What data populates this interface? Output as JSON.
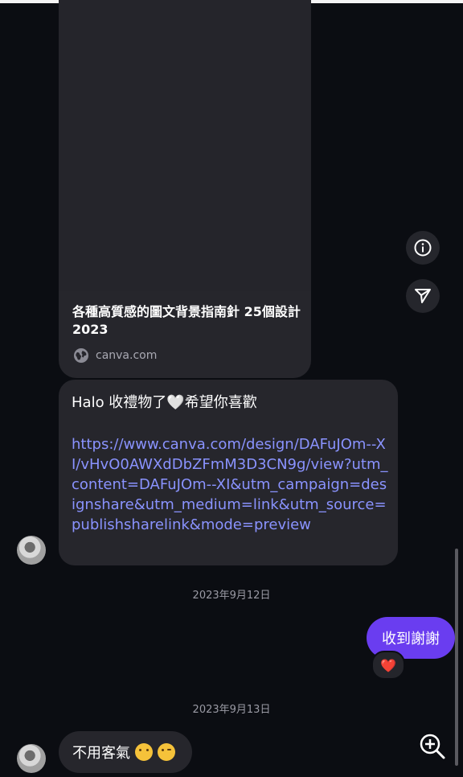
{
  "link_preview": {
    "title": "各種高質感的圖文背景指南針 25個設計 2023",
    "domain": "canva.com"
  },
  "messages": {
    "received_link": {
      "text": "Halo 收禮物了🤍希望你喜歡",
      "link": "https://www.canva.com/design/DAFuJOm--XI/vHvO0AWXdDbZFmM3D3CN9g/view?utm_content=DAFuJOm--XI&utm_campaign=designshare&utm_medium=link&utm_source=publishsharelink&mode=preview"
    },
    "date1": "2023年9月12日",
    "sent": {
      "text": "收到謝謝",
      "reaction": "❤️"
    },
    "date2": "2023年9月13日",
    "received_last": {
      "text": "不用客氣"
    }
  },
  "colors": {
    "bubble_received": "#26262c",
    "bubble_sent": "#6a3df0",
    "link": "#8a93ff"
  },
  "icons": [
    "globe-icon",
    "info-icon",
    "share-icon",
    "zoom-in-icon"
  ]
}
